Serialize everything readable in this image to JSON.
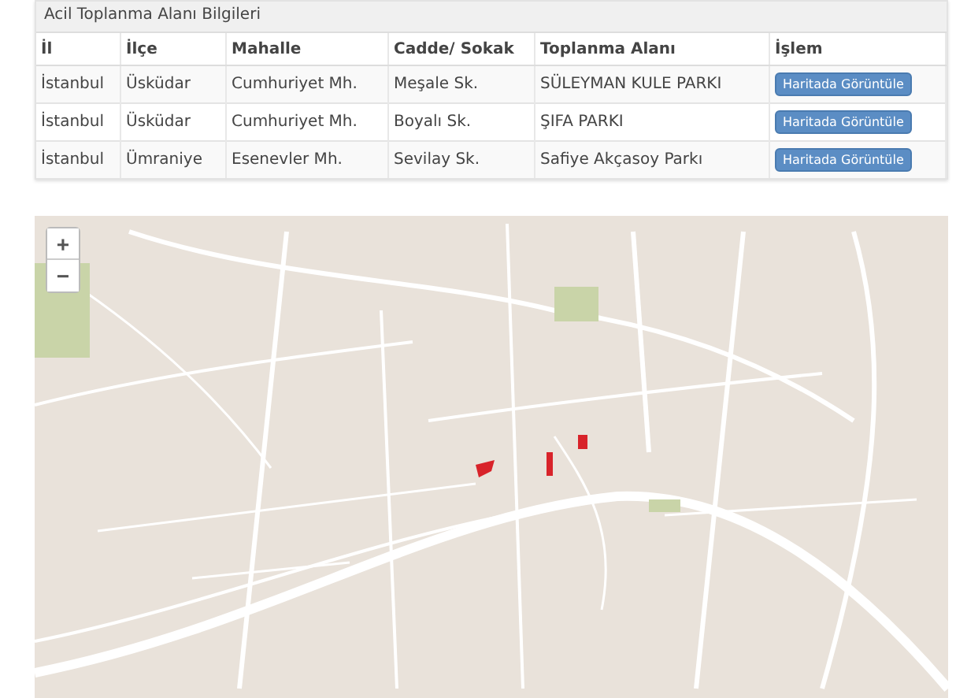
{
  "panel": {
    "title": "Acil Toplanma Alanı Bilgileri"
  },
  "table": {
    "columns": [
      "İl",
      "İlçe",
      "Mahalle",
      "Cadde/ Sokak",
      "Toplanma Alanı",
      "İşlem"
    ],
    "rows": [
      {
        "cells": [
          "İstanbul",
          "Üsküdar",
          "Cumhuriyet Mh.",
          "Meşale Sk.",
          "SÜLEYMAN KULE PARKI"
        ],
        "button": "Haritada Görüntüle"
      },
      {
        "cells": [
          "İstanbul",
          "Üsküdar",
          "Cumhuriyet Mh.",
          "Boyalı Sk.",
          "ŞIFA PARKI"
        ],
        "button": "Haritada Görüntüle"
      },
      {
        "cells": [
          "İstanbul",
          "Ümraniye",
          "Esenevler Mh.",
          "Sevilay Sk.",
          "Safiye Akçasoy Parkı"
        ],
        "button": "Haritada Görüntüle"
      }
    ]
  },
  "map": {
    "zoom_in": "+",
    "zoom_out": "−"
  }
}
